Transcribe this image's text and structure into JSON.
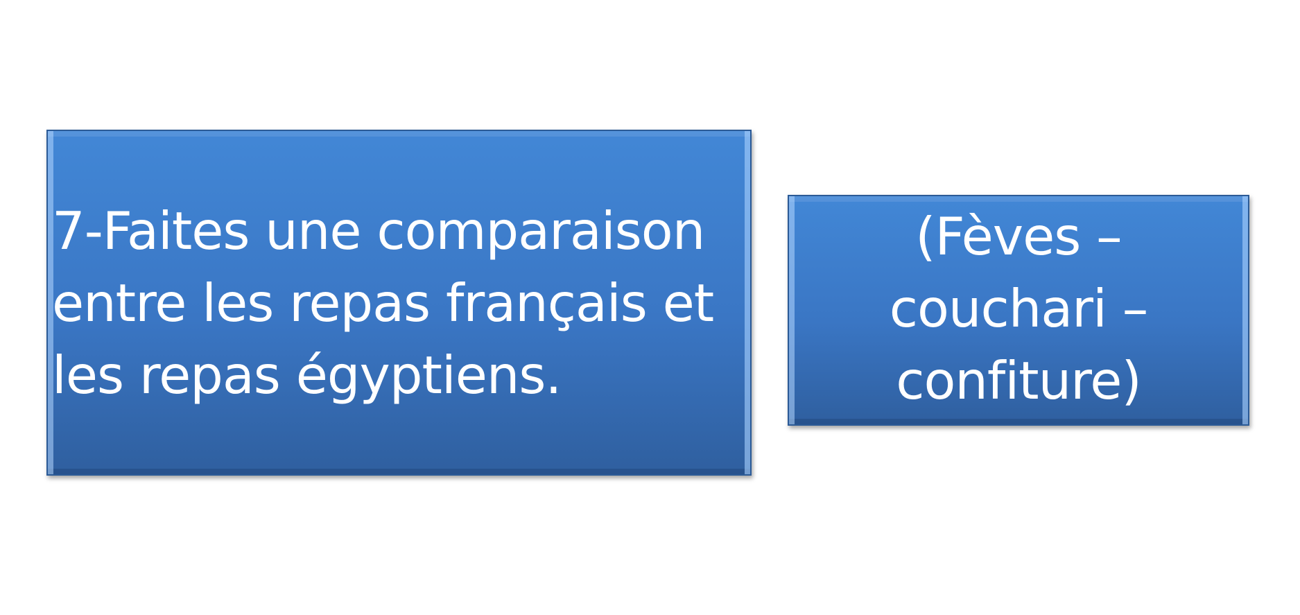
{
  "slide": {
    "question_box": {
      "text": "7-Faites une comparaison\nentre les repas français et\nles repas égyptiens."
    },
    "answer_box": {
      "text": "(Fèves –\ncouchari –\nconfiture)"
    }
  },
  "colors": {
    "background": "#ffffff",
    "box_fill": "#3a7bd5",
    "box_border": "#2b5a96",
    "text": "#ffffff"
  }
}
